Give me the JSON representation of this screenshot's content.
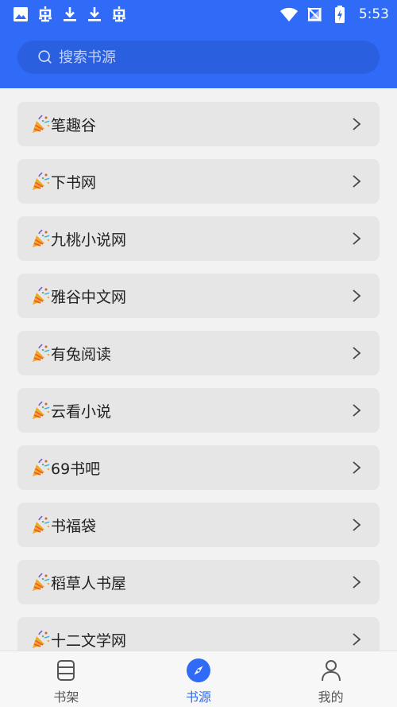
{
  "colors": {
    "header": "#2f6bf6",
    "search_bg": "#2a5fe0",
    "list_item_bg": "#e6e6e6",
    "page_bg": "#f2f2f2",
    "active_tab": "#2f6bf6",
    "inactive_tab": "#555555"
  },
  "statusbar": {
    "left_icons": [
      "image-icon",
      "bug-icon",
      "download-icon",
      "download-icon",
      "bug-icon"
    ],
    "right_icons": [
      "wifi-icon",
      "no-signal-icon",
      "battery-charging-icon"
    ],
    "time": "5:53"
  },
  "search": {
    "placeholder": "搜索书源",
    "value": ""
  },
  "sources": [
    {
      "label": "笔趣谷",
      "icon": "party-popper-icon"
    },
    {
      "label": "下书网",
      "icon": "party-popper-icon"
    },
    {
      "label": "九桃小说网",
      "icon": "party-popper-icon"
    },
    {
      "label": "雅谷中文网",
      "icon": "party-popper-icon"
    },
    {
      "label": "有兔阅读",
      "icon": "party-popper-icon"
    },
    {
      "label": "云看小说",
      "icon": "party-popper-icon"
    },
    {
      "label": "69书吧",
      "icon": "party-popper-icon"
    },
    {
      "label": "书福袋",
      "icon": "party-popper-icon"
    },
    {
      "label": "稻草人书屋",
      "icon": "party-popper-icon"
    },
    {
      "label": "十二文学网",
      "icon": "party-popper-icon"
    }
  ],
  "bottom_nav": [
    {
      "label": "书架",
      "icon": "bookshelf-icon",
      "active": false
    },
    {
      "label": "书源",
      "icon": "compass-icon",
      "active": true
    },
    {
      "label": "我的",
      "icon": "person-icon",
      "active": false
    }
  ]
}
